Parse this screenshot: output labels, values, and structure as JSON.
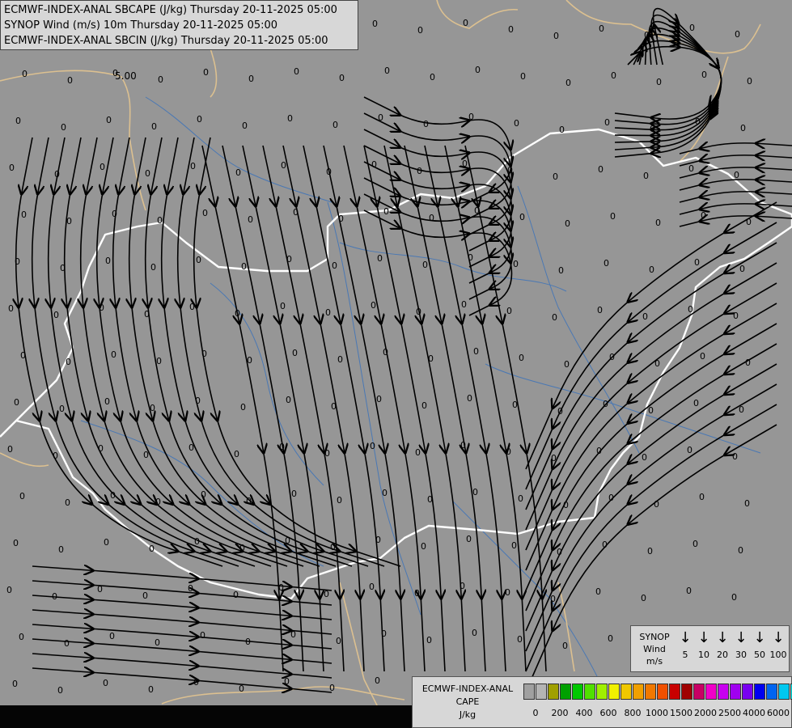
{
  "header": {
    "lines": [
      "ECMWF-INDEX-ANAL SBCAPE (J/kg) Thursday 20-11-2025 05:00",
      "SYNOP Wind (m/s) 10m Thursday 20-11-2025 05:00",
      "ECMWF-INDEX-ANAL SBCIN (J/kg) Thursday 20-11-2025 05:00"
    ]
  },
  "map": {
    "colors": {
      "background": "#969696",
      "country_border": "#dcc090",
      "national_border": "#ffffff",
      "rivers": "#4a78b4",
      "streamlines": "#000000",
      "labels": "#000000"
    },
    "cin_contour_label": "5.00",
    "grid_value_label": "0"
  },
  "wind_legend": {
    "title_lines": [
      "SYNOP",
      "Wind",
      "m/s"
    ],
    "arrow_icon": "down-arrow-icon",
    "speeds": [
      "5",
      "10",
      "20",
      "30",
      "50",
      "100"
    ]
  },
  "cape_legend": {
    "title_lines": [
      "ECMWF-INDEX-ANAL",
      "CAPE",
      "J/kg"
    ],
    "colors": [
      "#a0a0a0",
      "#b4b4b4",
      "#a0a000",
      "#00a000",
      "#00c800",
      "#50e000",
      "#a0f000",
      "#f0f000",
      "#f0c800",
      "#f0a000",
      "#f07800",
      "#f05000",
      "#c80000",
      "#a00000",
      "#c80064",
      "#f000c8",
      "#c800f0",
      "#a000f0",
      "#7800f0",
      "#0000f0",
      "#0064f0",
      "#00c8f0",
      "#00f0f0",
      "#a0f0f0",
      "#ffffff"
    ],
    "ticks": [
      "0",
      "200",
      "400",
      "600",
      "800",
      "1000",
      "1500",
      "2000",
      "2500",
      "4000",
      "6000"
    ]
  }
}
